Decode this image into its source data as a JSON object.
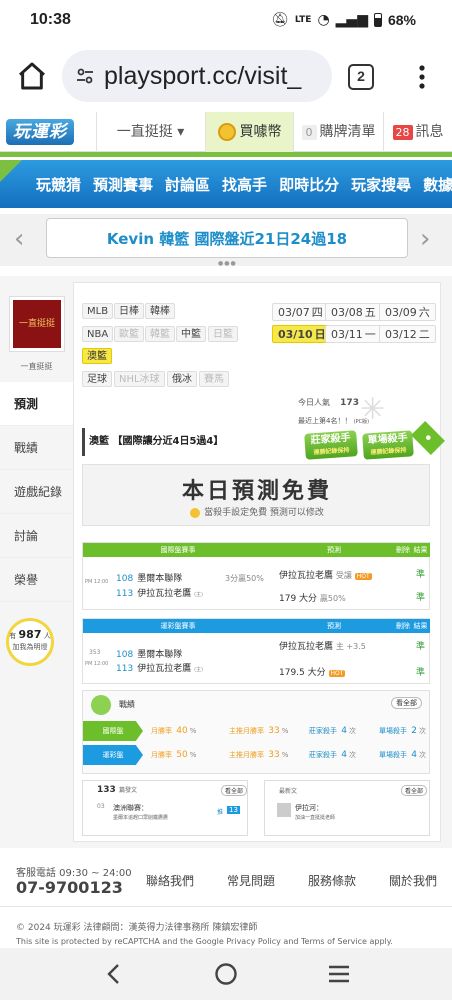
{
  "status": {
    "time": "10:38",
    "battery": "68%"
  },
  "browser": {
    "url": "playsport.cc/visit_",
    "tab_count": "2"
  },
  "topnav": {
    "logo": "玩運彩",
    "browse": "一直挺挺 ▾",
    "buy": "買噱幣",
    "cart_count": "0",
    "cart": "購牌清單",
    "msg_count": "28",
    "msg": "訊息"
  },
  "bluenav": [
    "玩競猜",
    "預測賽事",
    "討論區",
    "找高手",
    "即時比分",
    "玩家搜尋",
    "數據"
  ],
  "marquee": "Kevin 韓籃 國際盤近21日24過18",
  "sidebar": {
    "avatar_text": "一直挺挺",
    "name": "一直挺挺",
    "tabs": [
      "預測",
      "戰績",
      "遊戲紀錄",
      "討論",
      "榮譽"
    ],
    "fans_pre": "有",
    "fans_count": "987",
    "fans_post": "人",
    "fans_line2": "加我為明燈"
  },
  "leagues": {
    "row1": [
      "MLB",
      "日棒",
      "韓棒"
    ],
    "row2": [
      "NBA",
      "歐籃",
      "韓籃",
      "中籃",
      "日籃"
    ],
    "row3": [
      "澳籃"
    ],
    "row4": [
      "足球",
      "NHL冰球",
      "俄冰",
      "賽馬"
    ]
  },
  "dates": [
    {
      "d": "03/07",
      "w": "四"
    },
    {
      "d": "03/08",
      "w": "五"
    },
    {
      "d": "03/09",
      "w": "六"
    },
    {
      "d": "03/10",
      "w": "日"
    },
    {
      "d": "03/11",
      "w": "一"
    },
    {
      "d": "03/12",
      "w": "二"
    }
  ],
  "stats": {
    "views_label": "今日人氣",
    "views": "173",
    "rank_label": "最近上第4名！！",
    "rank_sub": "(PC版)"
  },
  "league_title": "澳籃 【國際讓分近4日5過4】",
  "badges": [
    {
      "t": "莊家殺手",
      "s": "連勝記錄保持"
    },
    {
      "t": "單場殺手",
      "s": "連勝記錄保持"
    }
  ],
  "free": {
    "title": "本日預測免費",
    "sub": "當殺手設定免費 預測可以修改"
  },
  "table1": {
    "headers": [
      "國際盤賽事",
      "預測",
      "刪除",
      "結果"
    ],
    "time": "PM 12:00",
    "home_no": "108",
    "home": "墨爾本聯隊",
    "away_no": "113",
    "away": "伊拉瓦拉老鷹",
    "away_tag": "(主)",
    "line": "3分",
    "pct": "贏50%",
    "pred1": "伊拉瓦拉老鷹",
    "pred1_tag": "受讓",
    "pred2": "179 大分",
    "pred2_pct": "贏50%",
    "result1": "準",
    "result2": "準"
  },
  "table2": {
    "headers": [
      "運彩盤賽事",
      "預測",
      "刪除",
      "結果"
    ],
    "game": "353",
    "time": "PM 12:00",
    "home_no": "108",
    "home": "墨爾本聯隊",
    "away_no": "113",
    "away": "伊拉瓦拉老鷹",
    "away_tag": "(主)",
    "pred1": "伊拉瓦拉老鷹",
    "pred1_line": "主 +3.5",
    "pred2": "179.5 大分",
    "result1": "準",
    "result2": "準"
  },
  "record": {
    "title": "戰績",
    "more": "看全部",
    "rows": [
      {
        "label": "國際盤",
        "a": "月勝率",
        "av": "40",
        "b": "主推月勝率",
        "bv": "33",
        "c": "莊家殺手",
        "cv": "4",
        "d": "單場殺手",
        "dv": "2"
      },
      {
        "label": "運彩盤",
        "a": "月勝率",
        "av": "50",
        "b": "主推月勝率",
        "bv": "33",
        "c": "莊家殺手",
        "cv": "4",
        "d": "單場殺手",
        "dv": "4"
      }
    ]
  },
  "cards": {
    "left_count": "133",
    "left_label": "篇發文",
    "left_more": "看全部",
    "left_num": "03",
    "left_title": "澳洲聯賽：",
    "left_desc": "墨爾本追趕口眾削鐵鷹鷹",
    "left_badge1": "推",
    "left_badge2": "13",
    "right_label": "最新文",
    "right_more": "看全部",
    "right_title": "伊拉河：",
    "right_desc": "加油一直挺挺老師"
  },
  "footer": {
    "phone_label": "客服電話 09:30 ~ 24:00",
    "phone": "07-9700123",
    "links": [
      "聯絡我們",
      "常見問題",
      "服務條款",
      "關於我們"
    ],
    "copyright": "© 2024 玩運彩 法律顧問：漢英得力法律事務所 陳鎮宏律師",
    "recaptcha": "This site is protected by reCAPTCHA and the Google Privacy Policy and Terms of Service apply."
  }
}
